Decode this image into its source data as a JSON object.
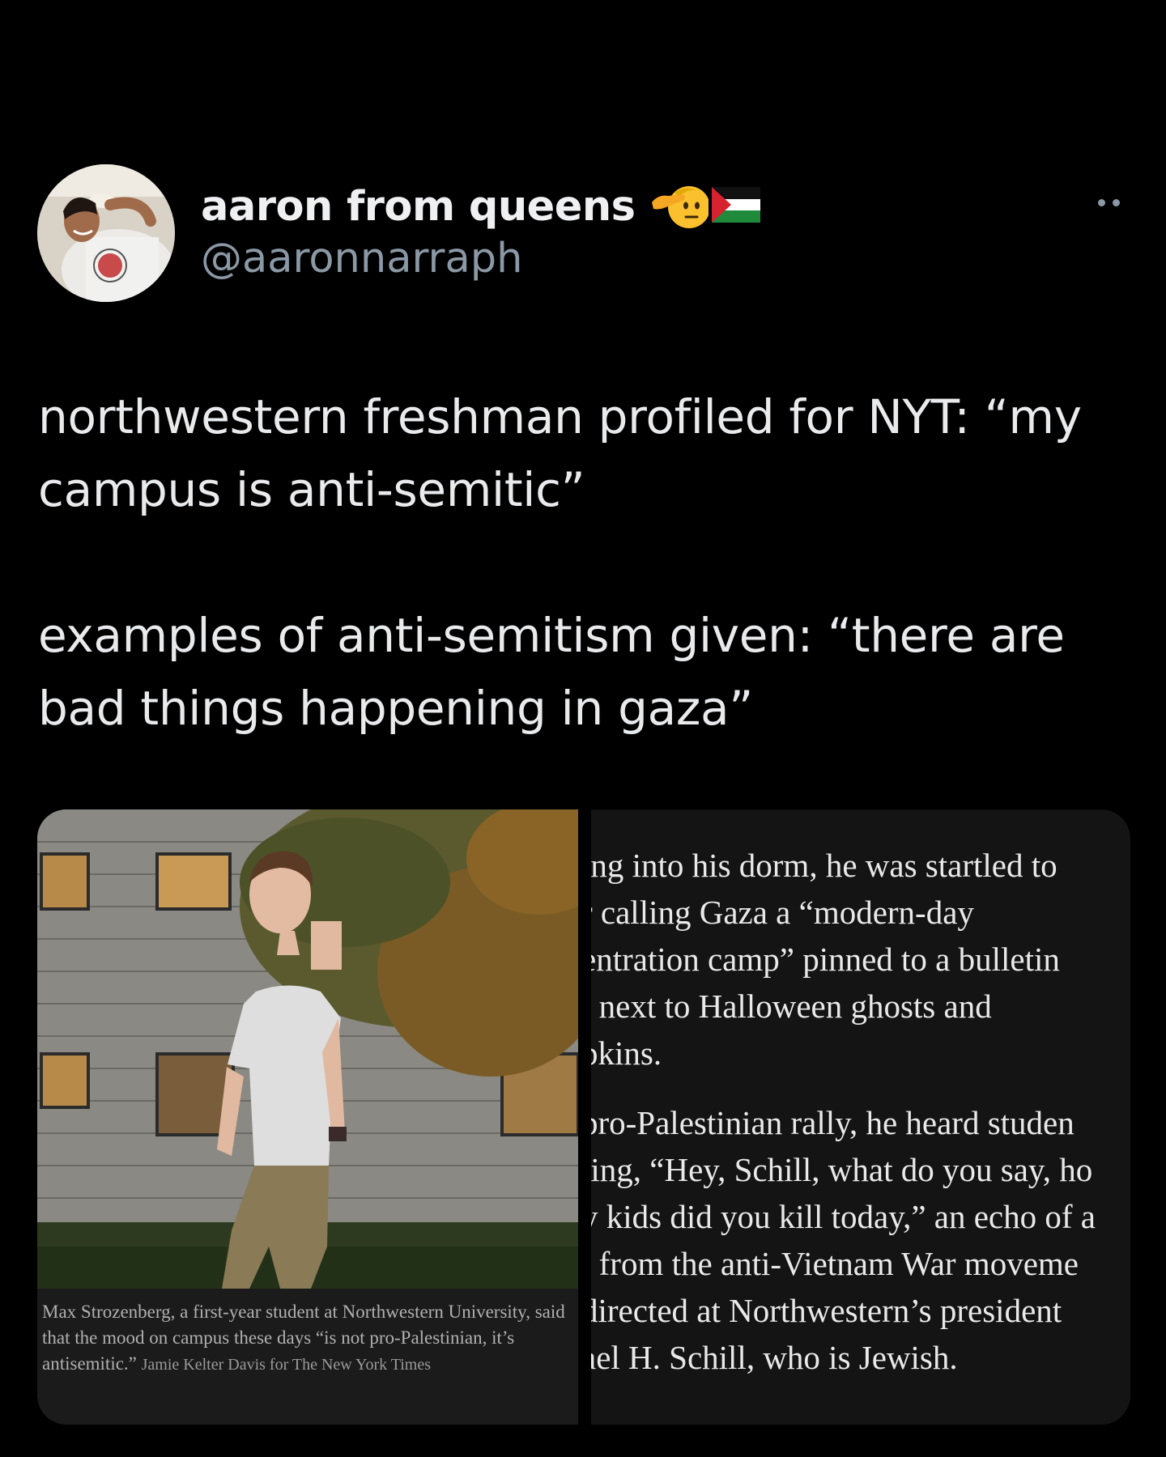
{
  "author": {
    "display_name": "aaron from queens",
    "handle": "@aaronnarraph",
    "emojis": [
      "saluting-face-emoji",
      "palestine-flag-emoji"
    ]
  },
  "tweet": {
    "paragraphs": [
      "northwestern freshman profiled for NYT: “my campus is anti-semitic”",
      "examples of anti-semitism given: “there are bad things happening in gaza”"
    ]
  },
  "media": {
    "caption": "Max Strozenberg, a first-year student at Northwestern University, said that the mood on campus these days “is not pro-Palestinian, it’s antisemitic.”",
    "credit": "Jamie Kelter Davis for The New York Times",
    "article_lines": [
      "ing into his dorm, he was startled to",
      "r calling Gaza a “modern-day",
      "entration camp” pinned to a bulletin",
      "l next to Halloween ghosts and",
      "pkins.",
      "pro-Palestinian rally, he heard studen",
      "ting, “Hey, Schill, what do you say, ho",
      "y kids did you kill today,” an echo of a",
      "t from the anti-Vietnam War moveme",
      "directed at Northwestern’s president",
      "ael H. Schill, who is Jewish."
    ]
  },
  "colors": {
    "background": "#000000",
    "text_primary": "#e7e9ea",
    "text_secondary": "#8b98a5",
    "article_bg": "#141414"
  }
}
